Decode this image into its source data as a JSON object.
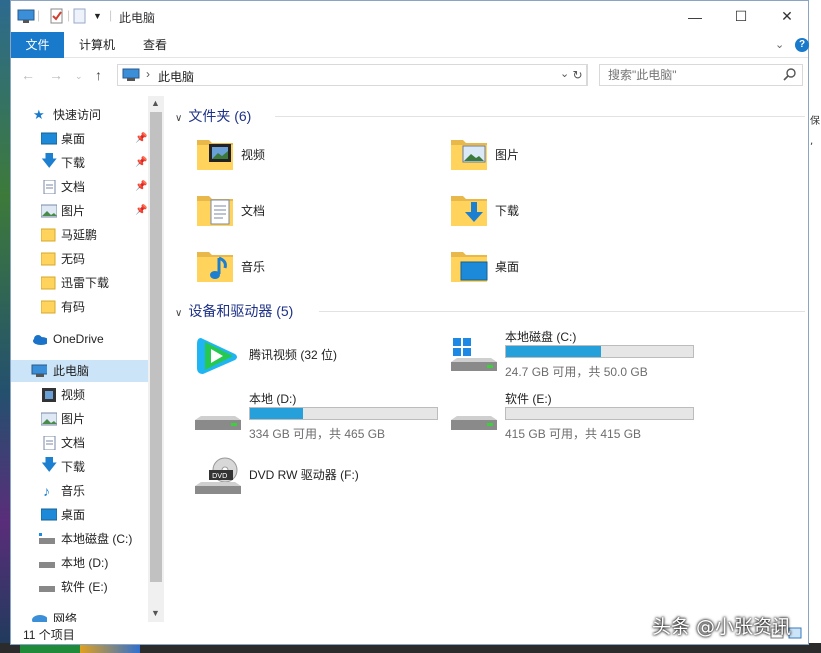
{
  "window": {
    "title": "此电脑"
  },
  "ribbon": {
    "tabs": [
      {
        "label": "文件"
      },
      {
        "label": "计算机"
      },
      {
        "label": "查看"
      }
    ],
    "help": "?"
  },
  "nav": {
    "path": "此电脑",
    "search_placeholder": "搜索\"此电脑\""
  },
  "sidebar": {
    "items": [
      {
        "label": "快速访问",
        "icon": "star-icon"
      },
      {
        "label": "桌面",
        "icon": "desktop-icon",
        "pinned": true
      },
      {
        "label": "下载",
        "icon": "download-icon",
        "pinned": true
      },
      {
        "label": "文档",
        "icon": "document-icon",
        "pinned": true
      },
      {
        "label": "图片",
        "icon": "picture-icon",
        "pinned": true
      },
      {
        "label": "马延鹏",
        "icon": "folder-icon"
      },
      {
        "label": "无码",
        "icon": "folder-icon"
      },
      {
        "label": "迅雷下载",
        "icon": "folder-icon"
      },
      {
        "label": "有码",
        "icon": "folder-icon"
      },
      {
        "label": "OneDrive",
        "icon": "cloud-icon"
      },
      {
        "label": "此电脑",
        "icon": "computer-icon",
        "selected": true
      },
      {
        "label": "视频",
        "icon": "video-icon"
      },
      {
        "label": "图片",
        "icon": "picture-icon"
      },
      {
        "label": "文档",
        "icon": "document-icon"
      },
      {
        "label": "下载",
        "icon": "download-icon"
      },
      {
        "label": "音乐",
        "icon": "music-icon"
      },
      {
        "label": "桌面",
        "icon": "desktop-icon"
      },
      {
        "label": "本地磁盘 (C:)",
        "icon": "drive-icon"
      },
      {
        "label": "本地 (D:)",
        "icon": "drive-icon"
      },
      {
        "label": "软件 (E:)",
        "icon": "drive-icon"
      },
      {
        "label": "网络",
        "icon": "network-icon"
      }
    ]
  },
  "content": {
    "folders_header": "文件夹 (6)",
    "folders": [
      {
        "label": "视频",
        "icon": "video-folder-icon"
      },
      {
        "label": "图片",
        "icon": "picture-folder-icon"
      },
      {
        "label": "文档",
        "icon": "document-folder-icon"
      },
      {
        "label": "下载",
        "icon": "download-folder-icon"
      },
      {
        "label": "音乐",
        "icon": "music-folder-icon"
      },
      {
        "label": "桌面",
        "icon": "desktop-folder-icon"
      }
    ],
    "devices_header": "设备和驱动器 (5)",
    "devices": [
      {
        "label": "腾讯视频 (32 位)",
        "icon": "tencent-video-icon"
      },
      {
        "label": "本地磁盘 (C:)",
        "space": "24.7 GB 可用，共 50.0 GB",
        "used_fraction": 0.506,
        "icon": "windows-drive-icon"
      },
      {
        "label": "本地 (D:)",
        "space": "334 GB 可用，共 465 GB",
        "used_fraction": 0.282,
        "icon": "drive-icon"
      },
      {
        "label": "软件 (E:)",
        "space": "415 GB 可用，共 415 GB",
        "used_fraction": 0.0,
        "icon": "drive-icon"
      },
      {
        "label": "DVD RW 驱动器 (F:)",
        "icon": "dvd-drive-icon"
      }
    ]
  },
  "status": {
    "count": "11 个项目"
  },
  "watermark": "头条 @小张资讯",
  "colors": {
    "accent": "#1979ca",
    "bar_fill": "#26a0da",
    "selected_bg": "#cce4f7",
    "header_text": "#1e3287"
  }
}
